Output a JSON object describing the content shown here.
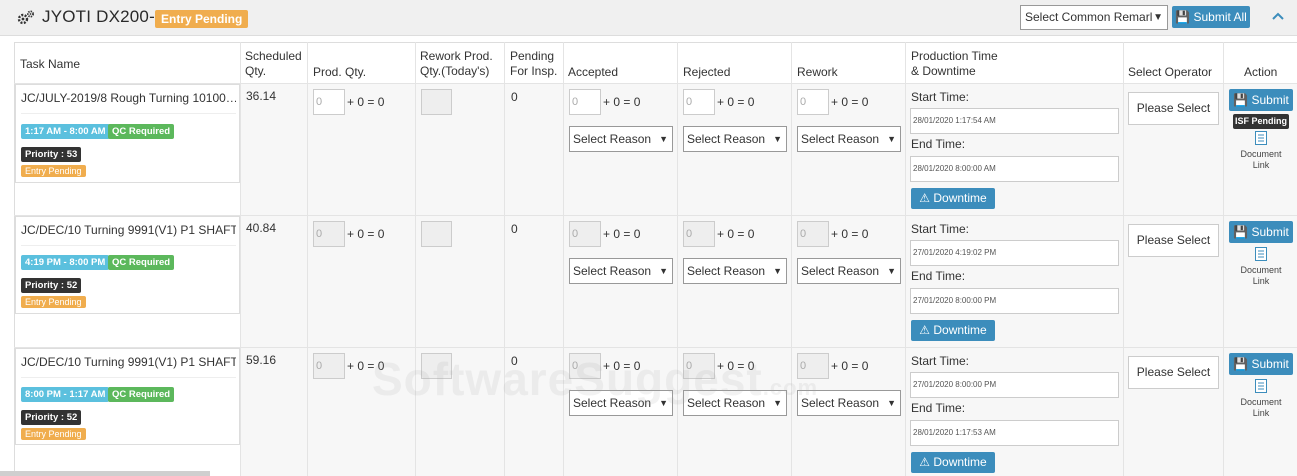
{
  "header": {
    "icon": "gears-icon",
    "title": "JYOTI DX200-1",
    "badge": "Entry Pending",
    "remark_select": "Select Common Remarl",
    "submit_all": "Submit All",
    "collapse_icon": "chevron-up-icon"
  },
  "columns": {
    "task_name": "Task Name",
    "scheduled_1": "Scheduled",
    "scheduled_2": "Qty.",
    "prod_qty": "Prod. Qty.",
    "rework_1": "Rework Prod.",
    "rework_2": "Qty.(Today's)",
    "pending_1": "Pending",
    "pending_2": "For Insp.",
    "accepted": "Accepted",
    "rejected": "Rejected",
    "rework": "Rework",
    "prodtime_1": "Production Time",
    "prodtime_2": "& Downtime",
    "operator": "Select Operator",
    "action": "Action"
  },
  "labels": {
    "qty_suffix": "+ 0 = 0",
    "qty_placeholder": "0",
    "select_reason": "Select Reason",
    "start_time": "Start Time:",
    "end_time": "End Time:",
    "downtime": "Downtime",
    "please_select": "Please Select",
    "submit": "Submit",
    "document_1": "Document",
    "document_2": "Link",
    "isf_pending": "ISF Pending"
  },
  "rows": [
    {
      "task": "JC/JULY-2019/8 Rough Turning 10100…",
      "time_badge": "1:17 AM - 8:00 AM",
      "qc_badge": "QC Required",
      "priority": "Priority : 53",
      "status": "Entry Pending",
      "scheduled": "36.14",
      "pending": "0",
      "start": "28/01/2020 1:17:54 AM",
      "end": "28/01/2020 8:00:00 AM",
      "isf": true
    },
    {
      "task": "JC/DEC/10 Turning 9991(V1) P1 SHAFT",
      "time_badge": "4:19 PM - 8:00 PM",
      "qc_badge": "QC Required",
      "priority": "Priority : 52",
      "status": "Entry Pending",
      "scheduled": "40.84",
      "pending": "0",
      "start": "27/01/2020 4:19:02 PM",
      "end": "27/01/2020 8:00:00 PM",
      "isf": false
    },
    {
      "task": "JC/DEC/10 Turning 9991(V1) P1 SHAFT",
      "time_badge": "8:00 PM - 1:17 AM",
      "qc_badge": "QC Required",
      "priority": "Priority : 52",
      "status": "Entry Pending",
      "scheduled": "59.16",
      "pending": "0",
      "start": "27/01/2020 8:00:00 PM",
      "end": "28/01/2020 1:17:53 AM",
      "isf": false
    }
  ],
  "watermark": {
    "main": "SoftwareSuggest",
    "suffix": ".com"
  },
  "colors": {
    "primary": "#3c8dbc",
    "warning": "#f0ad4e",
    "info": "#5bc0de",
    "success": "#5cb85c",
    "dark": "#333333"
  }
}
